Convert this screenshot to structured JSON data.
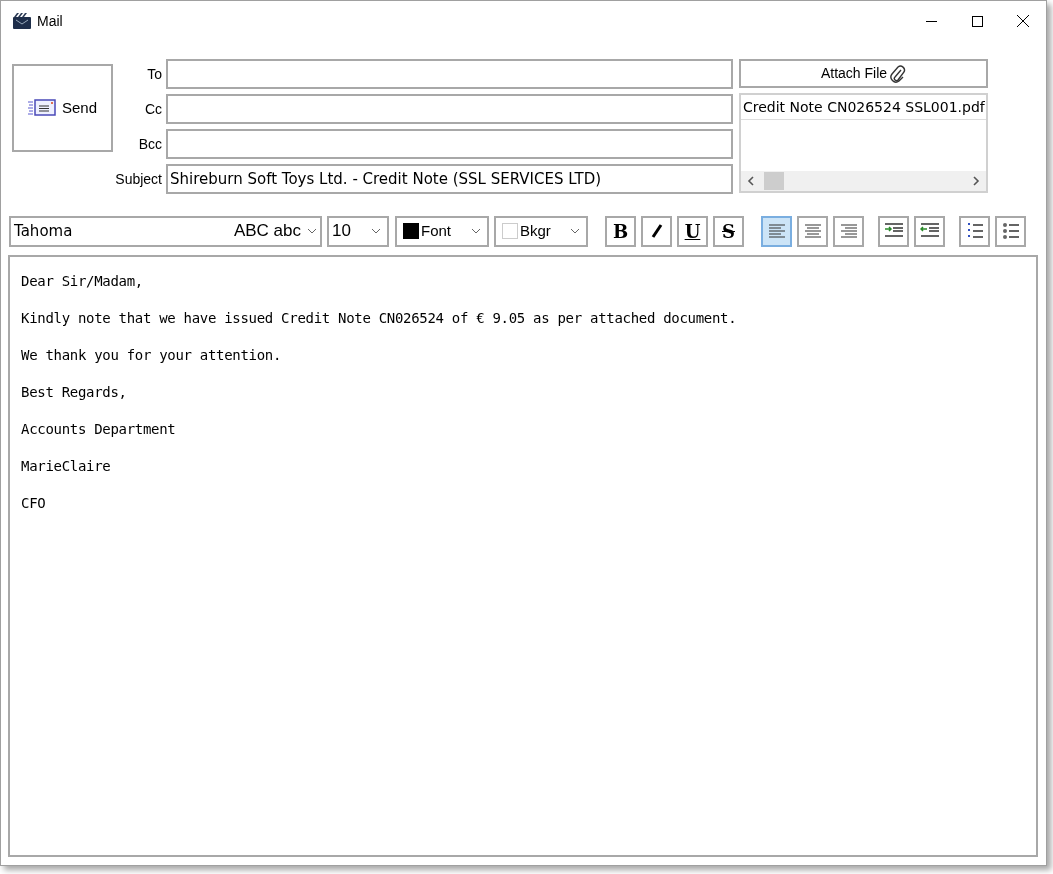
{
  "window": {
    "title": "Mail"
  },
  "send_button": {
    "label": "Send"
  },
  "address_fields": [
    {
      "label": "To"
    },
    {
      "label": "Cc"
    },
    {
      "label": "Bcc"
    },
    {
      "label": "Subject",
      "value": "Shireburn Soft Toys Ltd. - Credit Note (SSL SERVICES LTD)"
    }
  ],
  "attach_button": {
    "label": "Attach File"
  },
  "attachments": [
    "Credit Note CN026524 SSL001.pdf"
  ],
  "toolbar": {
    "font_family": "Tahoma",
    "font_preview": "ABC abc",
    "font_size": "10",
    "text_color_label": "Font",
    "background_color_label": "Bkgr",
    "format_buttons": [
      {
        "kind": "bold",
        "label": "B"
      },
      {
        "kind": "underline",
        "label": "U"
      },
      {
        "kind": "strike",
        "label": "S"
      }
    ],
    "align_buttons": [
      {
        "kind": "left",
        "selected": true
      },
      {
        "kind": "center",
        "selected": false
      },
      {
        "kind": "right",
        "selected": false
      }
    ]
  },
  "body": [
    "Dear Sir/Madam,",
    "Kindly note that we have issued Credit Note CN026524 of € 9.05 as per attached document.",
    "We thank you for your attention.",
    "Best Regards,",
    "Accounts Department",
    "MarieClaire",
    "CFO"
  ]
}
